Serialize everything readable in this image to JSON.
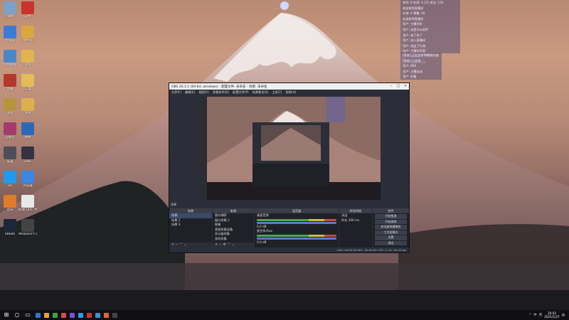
{
  "desktop_icons": [
    {
      "label": "回收站",
      "icon": "recycle-bin-icon",
      "color": "#7da0c8"
    },
    {
      "label": "软件",
      "icon": "app-icon",
      "color": "#c8342b"
    },
    {
      "label": "此电脑",
      "icon": "computer-icon",
      "color": "#3b7bd4"
    },
    {
      "label": "文件夹",
      "icon": "folder-icon",
      "color": "#d9a640"
    },
    {
      "label": "控制面板",
      "icon": "control-panel-icon",
      "color": "#4b86c9"
    },
    {
      "label": "资料",
      "icon": "folder-icon",
      "color": "#e0b451"
    },
    {
      "label": "直播",
      "icon": "app-icon",
      "color": "#b33a2a"
    },
    {
      "label": "工具",
      "icon": "folder-icon",
      "color": "#e6bb55"
    },
    {
      "label": "游戏",
      "icon": "game-icon",
      "color": "#b8933e"
    },
    {
      "label": "项目",
      "icon": "folder-icon",
      "color": "#ddb04c"
    },
    {
      "label": "压缩包",
      "icon": "archive-icon",
      "color": "#a33b6c"
    },
    {
      "label": "网络",
      "icon": "network-icon",
      "color": "#2f68b8"
    },
    {
      "label": "设置",
      "icon": "settings-icon",
      "color": "#4c4f57"
    },
    {
      "label": "OBS",
      "icon": "obs-icon",
      "color": "#333344"
    },
    {
      "label": "QQ",
      "icon": "qq-icon",
      "color": "#1d9bf0"
    },
    {
      "label": "浏览器",
      "icon": "browser-icon",
      "color": "#3b86e0"
    },
    {
      "label": "音乐",
      "icon": "music-icon",
      "color": "#e07b2b"
    },
    {
      "label": "新建 DOC 文档",
      "icon": "document-icon",
      "color": "#e8e8e8"
    },
    {
      "label": "Steam",
      "icon": "steam-icon",
      "color": "#1b2838"
    },
    {
      "label": "Assassin's Creed",
      "icon": "game-icon",
      "color": "#444"
    }
  ],
  "chat_overlay": {
    "lines": [
      "房间: 8  在线: 1.2万  关注: 124",
      "欢迎来到直播间",
      "礼物: 0    弹幕: 16",
      "欢迎来到直播间",
      "用户: 主播你好",
      "用户: 这是什么软件",
      "用户: 来了来了",
      "用户: 进入直播间",
      "用户: 送出了礼物",
      "用户: 主播好厉害",
      "用户: 哈哈哈",
      "用户: 关注了主播"
    ],
    "lines2": [
      "[系统] 正在连接弹幕服务器",
      "[系统] 已连接",
      "用户: 666",
      "用户: 主播加油",
      "用户: 好看"
    ]
  },
  "obs": {
    "title": "OBS 26.1.1 (64-bit, windows) - 配置文件: 未命名 - 场景: 未命名",
    "menu": [
      "文件(F)",
      "编辑(E)",
      "视图(V)",
      "停靠部件(D)",
      "配置文件(P)",
      "场景集合(S)",
      "工具(T)",
      "帮助(H)"
    ],
    "status_text": "场景",
    "docks": {
      "scenes": {
        "title": "场景",
        "items": [
          "场景",
          "场景 2",
          "场景 3"
        ]
      },
      "sources": {
        "title": "来源",
        "items": [
          "窗口捕获",
          "窗口采集 2",
          "图像",
          "视频采集设备",
          "显示器采集",
          "游戏采集"
        ]
      },
      "mixer": {
        "title": "混音器",
        "items": [
          "桌面音频",
          "麦克风/Aux"
        ],
        "db": [
          "0.0 dB",
          "0.0 dB"
        ]
      },
      "transitions": {
        "title": "转场特效",
        "items": [
          "淡出",
          "时长 300 ms"
        ]
      },
      "controls": {
        "title": "控件",
        "buttons": [
          "开始推流",
          "开始录制",
          "启动虚拟摄像机",
          "工作室模式",
          "设置",
          "退出"
        ]
      }
    },
    "bottom_status": "LIVE: 00:00:00  REC: 00:00:00  CPU: 2.1%, 30.00 fps"
  },
  "taskbar": {
    "apps": [
      "#2f73d6",
      "#e8a33a",
      "#3aa64a",
      "#d94a4a",
      "#7a4fd6",
      "#2f9be0",
      "#cc3333",
      "#3e8ed0",
      "#e06a2c",
      "#444"
    ],
    "tray": [
      "^",
      "中",
      "英"
    ],
    "time": "20:02",
    "date": "2021/1/27"
  }
}
